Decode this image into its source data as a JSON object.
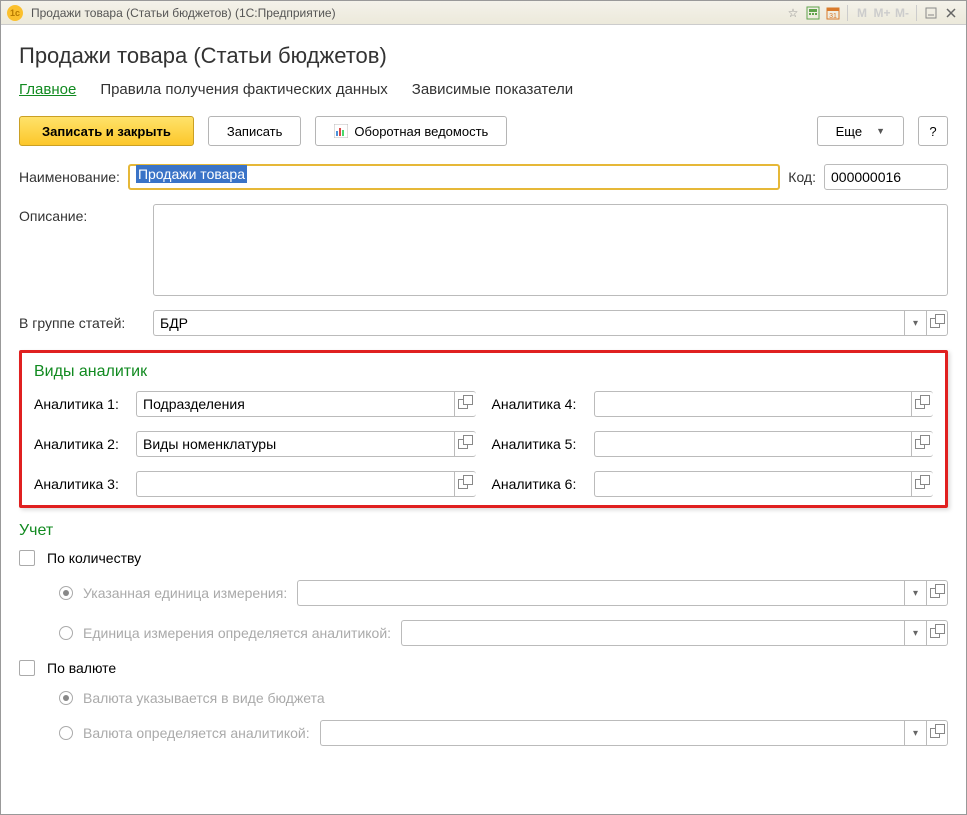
{
  "window": {
    "title": "Продажи товара (Статьи бюджетов)  (1С:Предприятие)"
  },
  "header": {
    "title": "Продажи товара (Статьи бюджетов)"
  },
  "tabs": {
    "main": "Главное",
    "rules": "Правила получения фактических данных",
    "dependent": "Зависимые показатели"
  },
  "toolbar": {
    "save_close": "Записать и закрыть",
    "save": "Записать",
    "report": "Оборотная ведомость",
    "more": "Еще",
    "help": "?"
  },
  "fields": {
    "name_label": "Наименование:",
    "name_value": "Продажи товара",
    "code_label": "Код:",
    "code_value": "000000016",
    "desc_label": "Описание:",
    "desc_value": "",
    "group_label": "В группе статей:",
    "group_value": "БДР"
  },
  "analytics": {
    "section_title": "Виды аналитик",
    "labels": [
      "Аналитика 1:",
      "Аналитика 2:",
      "Аналитика 3:",
      "Аналитика 4:",
      "Аналитика 5:",
      "Аналитика 6:"
    ],
    "values": [
      "Подразделения",
      "Виды номенклатуры",
      "",
      "",
      "",
      ""
    ]
  },
  "accounting": {
    "section_title": "Учет",
    "by_qty": "По количеству",
    "unit_specified": "Указанная единица измерения:",
    "unit_by_analytic": "Единица измерения определяется аналитикой:",
    "by_currency": "По валюте",
    "cur_budget": "Валюта указывается в виде бюджета",
    "cur_analytic": "Валюта определяется аналитикой:"
  }
}
